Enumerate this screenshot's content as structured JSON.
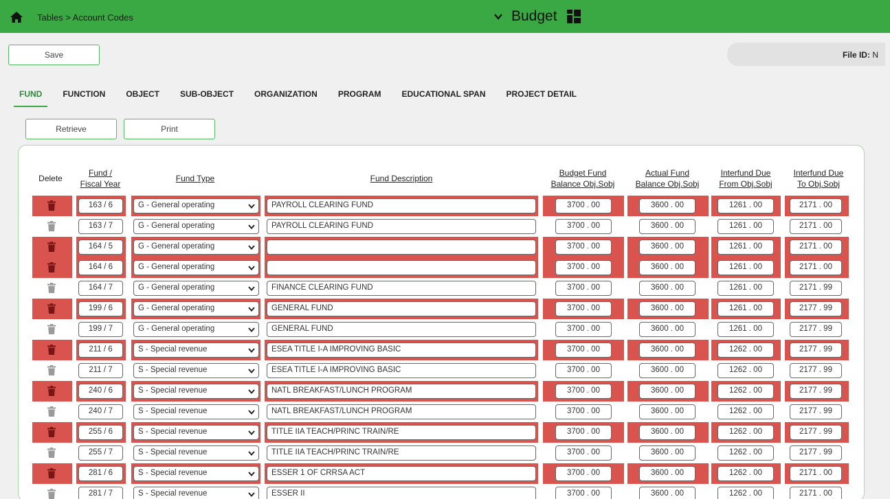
{
  "breadcrumb": "Tables > Account Codes",
  "module_title": "Budget",
  "toolbar": {
    "save_label": "Save",
    "file_id_label": "File ID:",
    "file_id_value": "N"
  },
  "tabs": [
    "FUND",
    "FUNCTION",
    "OBJECT",
    "SUB-OBJECT",
    "ORGANIZATION",
    "PROGRAM",
    "EDUCATIONAL SPAN",
    "PROJECT DETAIL"
  ],
  "buttons": {
    "retrieve": "Retrieve",
    "print": "Print"
  },
  "columns": {
    "delete": "Delete",
    "fund_fy_1": "Fund /",
    "fund_fy_2": "Fiscal Year",
    "fund_type": "Fund Type",
    "fund_desc": "Fund Description",
    "bud_1": "Budget Fund",
    "bud_2": "Balance Obj.Sobj",
    "act_1": "Actual Fund",
    "act_2": "Balance Obj.Sobj",
    "from_1": "Interfund Due",
    "from_2": "From Obj.Sobj",
    "to_1": "Interfund Due",
    "to_2": "To Obj.Sobj"
  },
  "rows": [
    {
      "error": true,
      "fund": "163 / 6",
      "type": "G - General operating",
      "desc": "PAYROLL CLEARING FUND",
      "budget": "3700 . 00",
      "actual": "3600 . 00",
      "due_from": "1261 . 00",
      "due_to": "2171 . 00"
    },
    {
      "error": false,
      "fund": "163 / 7",
      "type": "G - General operating",
      "desc": "PAYROLL CLEARING FUND",
      "budget": "3700 . 00",
      "actual": "3600 . 00",
      "due_from": "1261 . 00",
      "due_to": "2171 . 00"
    },
    {
      "error": true,
      "fund": "164 / 5",
      "type": "G - General operating",
      "desc": "",
      "budget": "3700 . 00",
      "actual": "3600 . 00",
      "due_from": "1261 . 00",
      "due_to": "2171 . 00"
    },
    {
      "error": true,
      "fund": "164 / 6",
      "type": "G - General operating",
      "desc": "",
      "budget": "3700 . 00",
      "actual": "3600 . 00",
      "due_from": "1261 . 00",
      "due_to": "2171 . 00"
    },
    {
      "error": false,
      "fund": "164 / 7",
      "type": "G - General operating",
      "desc": "FINANCE CLEARING FUND",
      "budget": "3700 . 00",
      "actual": "3600 . 00",
      "due_from": "1261 . 00",
      "due_to": "2171 . 99"
    },
    {
      "error": true,
      "fund": "199 / 6",
      "type": "G - General operating",
      "desc": "GENERAL FUND",
      "budget": "3700 . 00",
      "actual": "3600 . 00",
      "due_from": "1261 . 00",
      "due_to": "2177 . 99"
    },
    {
      "error": false,
      "fund": "199 / 7",
      "type": "G - General operating",
      "desc": "GENERAL FUND",
      "budget": "3700 . 00",
      "actual": "3600 . 00",
      "due_from": "1261 . 00",
      "due_to": "2177 . 99"
    },
    {
      "error": true,
      "fund": "211 / 6",
      "type": "S - Special revenue",
      "desc": "ESEA TITLE I-A IMPROVING BASIC",
      "budget": "3700 . 00",
      "actual": "3600 . 00",
      "due_from": "1262 . 00",
      "due_to": "2177 . 99"
    },
    {
      "error": false,
      "fund": "211 / 7",
      "type": "S - Special revenue",
      "desc": "ESEA TITLE I-A IMPROVING BASIC",
      "budget": "3700 . 00",
      "actual": "3600 . 00",
      "due_from": "1262 . 00",
      "due_to": "2177 . 99"
    },
    {
      "error": true,
      "fund": "240 / 6",
      "type": "S - Special revenue",
      "desc": "NATL BREAKFAST/LUNCH PROGRAM",
      "budget": "3700 . 00",
      "actual": "3600 . 00",
      "due_from": "1262 . 00",
      "due_to": "2177 . 99"
    },
    {
      "error": false,
      "fund": "240 / 7",
      "type": "S - Special revenue",
      "desc": "NATL BREAKFAST/LUNCH PROGRAM",
      "budget": "3700 . 00",
      "actual": "3600 . 00",
      "due_from": "1262 . 00",
      "due_to": "2177 . 99"
    },
    {
      "error": true,
      "fund": "255 / 6",
      "type": "S - Special revenue",
      "desc": "TITLE IIA TEACH/PRINC TRAIN/RE",
      "budget": "3700 . 00",
      "actual": "3600 . 00",
      "due_from": "1262 . 00",
      "due_to": "2177 . 99"
    },
    {
      "error": false,
      "fund": "255 / 7",
      "type": "S - Special revenue",
      "desc": "TITLE IIA TEACH/PRINC TRAIN/RE",
      "budget": "3700 . 00",
      "actual": "3600 . 00",
      "due_from": "1262 . 00",
      "due_to": "2177 . 99"
    },
    {
      "error": true,
      "fund": "281 / 6",
      "type": "S - Special revenue",
      "desc": "ESSER 1 OF CRRSA ACT",
      "budget": "3700 . 00",
      "actual": "3600 . 00",
      "due_from": "1262 . 00",
      "due_to": "2171 . 00"
    },
    {
      "error": false,
      "fund": "281 / 7",
      "type": "S - Special revenue",
      "desc": "ESSER II",
      "budget": "3700 . 00",
      "actual": "3600 . 00",
      "due_from": "1262 . 00",
      "due_to": "2171 . 00"
    }
  ],
  "colors": {
    "header_green": "#3aa843",
    "error_red": "#d9534f"
  },
  "icons": {
    "home": "home-icon",
    "module_chevron": "chevron-down-icon",
    "module_grid": "grid-icon",
    "delete": "trash-icon"
  }
}
